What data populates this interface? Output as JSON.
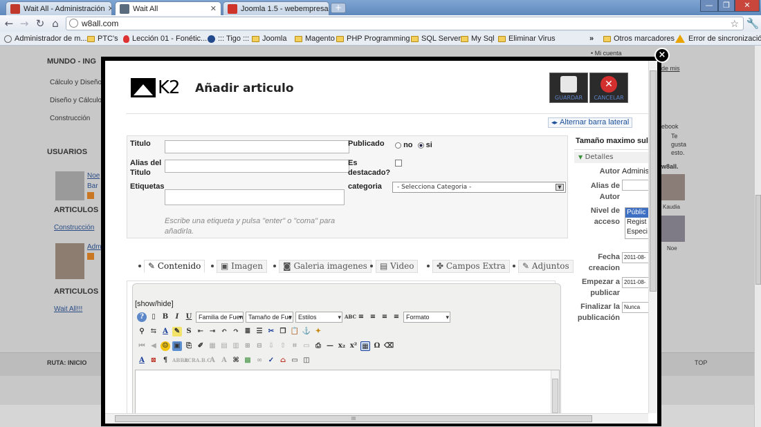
{
  "browser": {
    "tabs": [
      {
        "title": "Wait All - Administración",
        "favicon_color": "#c0392b"
      },
      {
        "title": "Wait All",
        "favicon_color": "#5b6b7e"
      },
      {
        "title": "Joomla 1.5 - webempresa.jc",
        "favicon_color": "#d0352c"
      }
    ],
    "new_tab": "+",
    "address": "w8all.com",
    "bookmarks": [
      {
        "label": "Administrador de m...",
        "icon": "globe-icon"
      },
      {
        "label": "PTC's",
        "icon": "folder-icon"
      },
      {
        "label": "Lección 01 - Fonétic...",
        "icon": "flame-icon"
      },
      {
        "label": "::: Tigo :::",
        "icon": "tigo-icon"
      },
      {
        "label": "Joomla",
        "icon": "folder-icon"
      },
      {
        "label": "Magento",
        "icon": "folder-icon"
      },
      {
        "label": "PHP Programming",
        "icon": "folder-icon"
      },
      {
        "label": "SQL Server",
        "icon": "folder-icon"
      },
      {
        "label": "My Sql",
        "icon": "folder-icon"
      },
      {
        "label": "Eliminar Virus",
        "icon": "folder-icon"
      }
    ],
    "more": "»",
    "other_bookmarks": "Otros marcadores",
    "sync_error": "Error de sincronización"
  },
  "background_page": {
    "heading_1": "MUNDO - ING",
    "menu": [
      "Cálculo y Diseño",
      "Diseño y Cálculo",
      "Construcción"
    ],
    "heading_users": "USUARIOS",
    "articles_1": "ARTICULOS",
    "link_1": "Construcción",
    "articles_2": "ARTICULOS",
    "link_2": "Wait All!!!",
    "user_1_name": "Noe",
    "user_1_sub": "Bar",
    "user_2_name": "Adm",
    "breadcrumb": "RUTA:  INICIO",
    "top_link": "TOP",
    "right_snippets": [
      "• Mi cuenta",
      "de mis",
      "ebook",
      "Te",
      "gusta",
      "esto.",
      "w8all.",
      "Kaudia",
      "Noe"
    ]
  },
  "modal": {
    "close": "×",
    "logo_text": "K2",
    "title": "Añadir articulo",
    "save_label": "GUARDAR",
    "cancel_label": "CANCELAR",
    "toggle_sidebar": "Alternar barra lateral",
    "form": {
      "title_label": "Titulo",
      "alias_label": "Alias del Titulo",
      "tags_label": "Etiquetas",
      "tags_hint": "Escribe una etiqueta y pulsa \"enter\" o \"coma\" para añadirla.",
      "published_label": "Publicado",
      "published_no": "no",
      "published_yes": "si",
      "featured_label": "Es destacado?",
      "category_label": "categoria",
      "category_value": "- Selecciona Categoria -"
    },
    "tabs": [
      {
        "label": "Contenido",
        "icon": "pencil-icon"
      },
      {
        "label": "Imagen",
        "icon": "image-icon"
      },
      {
        "label": "Galeria imagenes",
        "icon": "camera-icon"
      },
      {
        "label": "Video",
        "icon": "film-icon"
      },
      {
        "label": "Campos Extra",
        "icon": "puzzle-icon"
      },
      {
        "label": "Adjuntos",
        "icon": "paperclip-icon"
      }
    ],
    "editor": {
      "show_hide": "[show/hide]",
      "font_family": "Familia de Fuen",
      "font_size": "Tamaño de Fue",
      "styles": "Estilos",
      "format": "Formato"
    },
    "sidebar": {
      "header": "Tamaño maximo sul",
      "details": "Detalles",
      "author_label": "Autor",
      "author_value": "Adminis",
      "author_alias_label": "Alias de Autor",
      "access_label": "Nivel de acceso",
      "access_options": [
        "Públic",
        "Regist",
        "Especi"
      ],
      "created_label": "Fecha creacion",
      "created_value": "2011-08-",
      "publish_up_label": "Empezar a publicar",
      "publish_up_value": "2011-08-",
      "publish_down_label": "Finalizar la publicación",
      "publish_down_value": "Nunca"
    },
    "scroll_grip": "III"
  }
}
